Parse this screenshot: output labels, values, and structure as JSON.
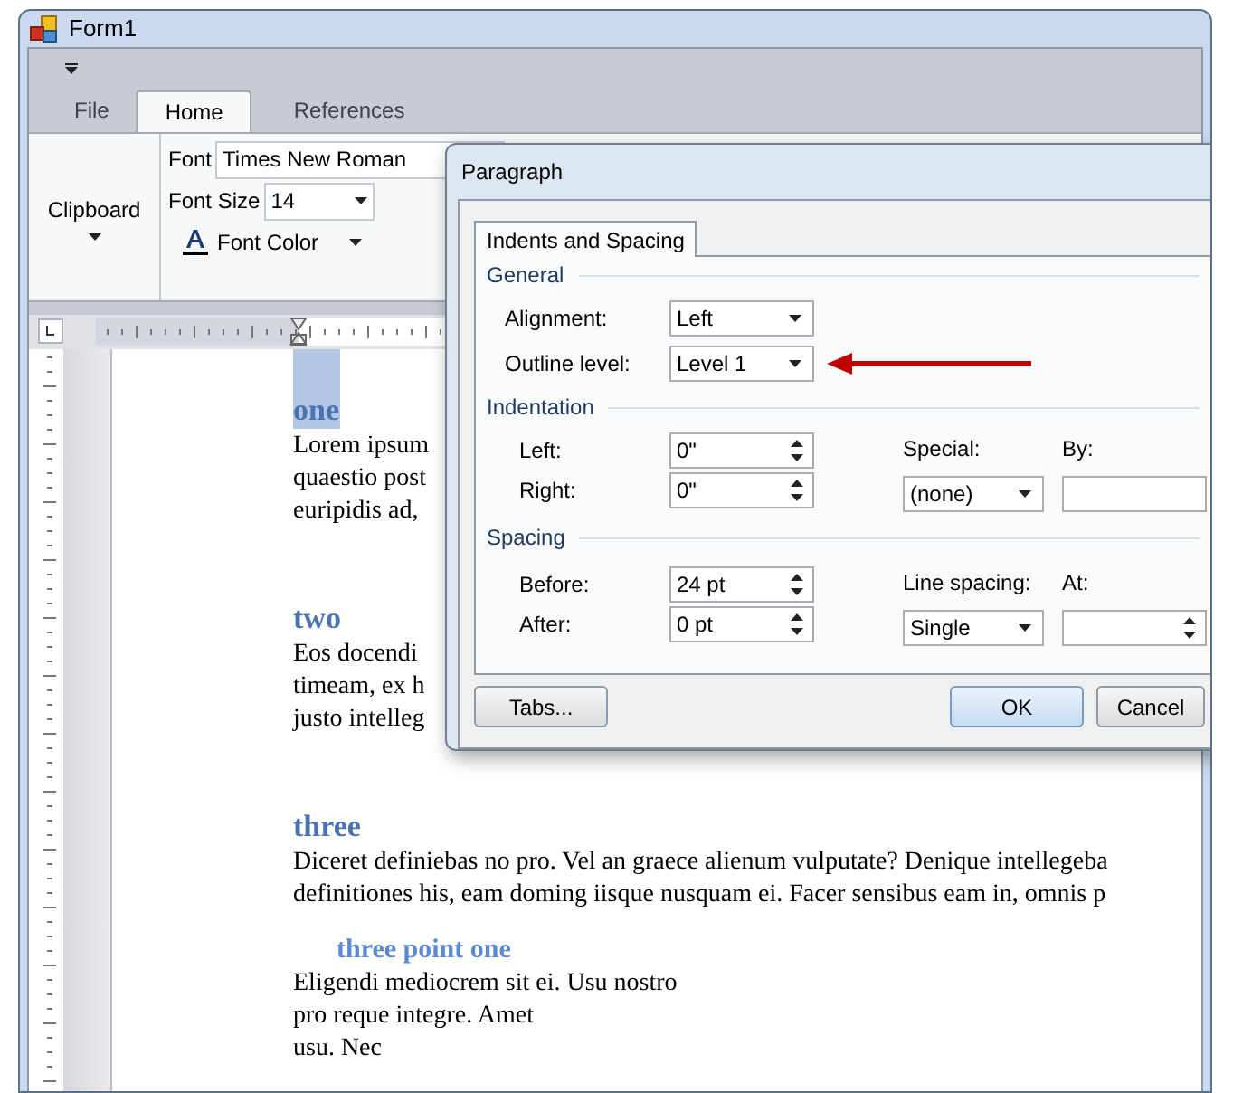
{
  "window": {
    "title": "Form1"
  },
  "ribbon": {
    "tabs": [
      {
        "label": "File",
        "selected": false
      },
      {
        "label": "Home",
        "selected": true
      },
      {
        "label": "References",
        "selected": false
      }
    ],
    "clipboard": "Clipboard",
    "font_label": "Font",
    "font_value": "Times New Roman",
    "font_size_label": "Font Size",
    "font_size_value": "14",
    "font_color": "Font Color"
  },
  "document": {
    "blocks": [
      {
        "kind": "heading1",
        "text": "one",
        "highlighted": true
      },
      {
        "kind": "body",
        "lines": [
          "Lorem ipsum",
          "quaestio post",
          "euripidis ad,"
        ]
      },
      {
        "kind": "heading1",
        "text": "two",
        "highlighted": false
      },
      {
        "kind": "body",
        "lines": [
          "Eos docendi",
          "timeam, ex h",
          "justo intelleg"
        ]
      },
      {
        "kind": "heading1",
        "text": "three",
        "highlighted": false
      },
      {
        "kind": "body",
        "lines": [
          "Diceret definiebas no pro. Vel an graece alienum vulputate? Denique intellegeba",
          "definitiones his, eam doming iisque nusquam ei. Facer sensibus eam in, omnis p"
        ]
      },
      {
        "kind": "heading2",
        "text": "three point one",
        "highlighted": false
      },
      {
        "kind": "body",
        "lines": [
          "Eligendi mediocrem sit ei. Usu nostro",
          "pro reque integre. Amet",
          "usu. Nec"
        ]
      }
    ]
  },
  "dialog": {
    "title": "Paragraph",
    "tabs": [
      {
        "label": "Indents and Spacing",
        "selected": true
      }
    ],
    "general": {
      "heading": "General",
      "alignment": {
        "label": "Alignment:",
        "value": "Left"
      },
      "outline_level": {
        "label": "Outline level:",
        "value": "Level 1"
      }
    },
    "indentation": {
      "heading": "Indentation",
      "left": {
        "label": "Left:",
        "value": "0\""
      },
      "right": {
        "label": "Right:",
        "value": "0\""
      },
      "special": {
        "label": "Special:",
        "value": "(none)"
      },
      "by": {
        "label": "By:"
      }
    },
    "spacing": {
      "heading": "Spacing",
      "before": {
        "label": "Before:",
        "value": "24 pt"
      },
      "after": {
        "label": "After:",
        "value": "0 pt"
      },
      "line_spacing": {
        "label": "Line spacing:",
        "value": "Single"
      },
      "at": {
        "label": "At:"
      }
    },
    "buttons": {
      "tabs": "Tabs...",
      "ok": "OK",
      "cancel": "Cancel"
    }
  }
}
